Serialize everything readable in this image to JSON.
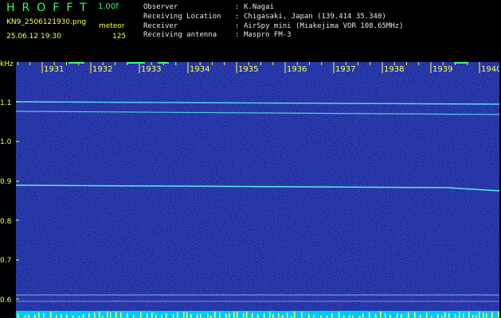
{
  "header": {
    "app_title": "HROFFT",
    "version": "1.00f",
    "filename": "KN9_2506121930.png",
    "mode": "meteor",
    "datetime": "25.06.12 19:30",
    "count": "125"
  },
  "info": [
    {
      "label": "Observer",
      "value": "K.Nagai"
    },
    {
      "label": "Receiving Location",
      "value": "Chigasaki, Japan (139.414 35.340)"
    },
    {
      "label": "Receiver",
      "value": "AirSpy mini (Miakejima VOR 108.65MHz)"
    },
    {
      "label": "Receiving antenna",
      "value": "Maspro FM-3"
    }
  ],
  "spectrogram": {
    "y_unit": "kHz",
    "y_ticks": [
      "1.1",
      "1.0",
      "0.9",
      "0.8",
      "0.7",
      "0.6"
    ],
    "time_labels": [
      "1931",
      "1932",
      "1933",
      "1934",
      "1935",
      "1936",
      "1937",
      "1938",
      "1939",
      "1940"
    ],
    "colors": {
      "background": "#1a2a9a",
      "signal": "#5ffff0",
      "axis_text": "#ffff3a"
    }
  }
}
